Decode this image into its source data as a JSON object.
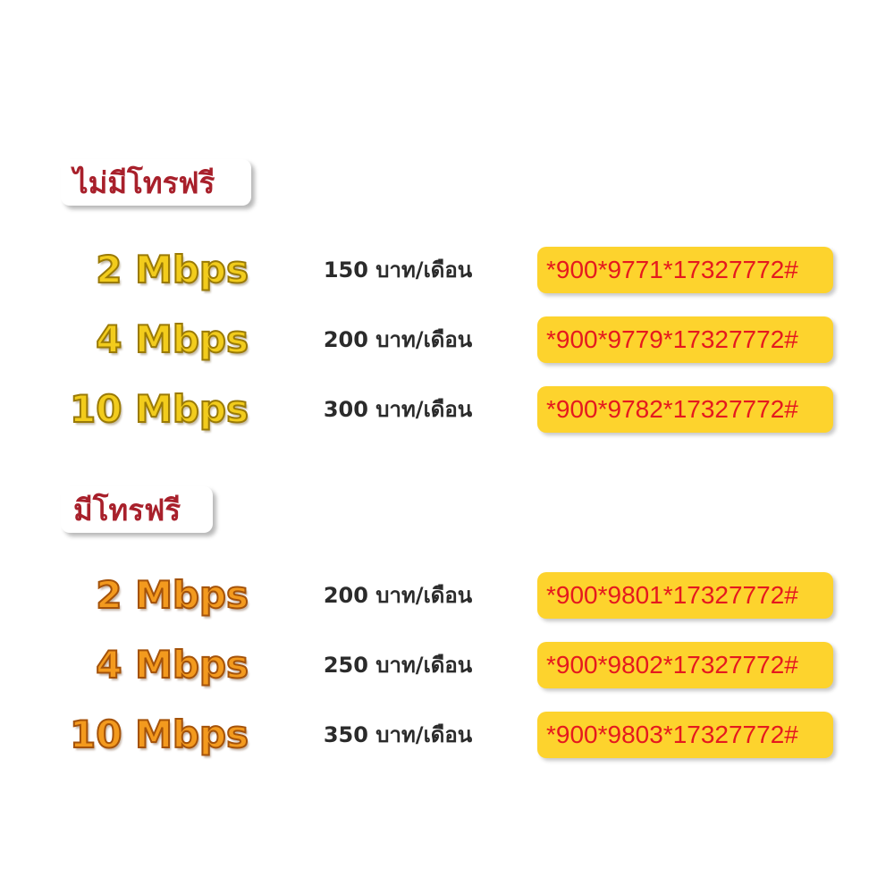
{
  "sections": [
    {
      "label": "ไม่มีโทรฟรี",
      "plans": [
        {
          "speed": "2 Mbps",
          "price": "150 บาท/เดือน",
          "code": "*900*9771*17327772#"
        },
        {
          "speed": "4 Mbps",
          "price": "200 บาท/เดือน",
          "code": "*900*9779*17327772#"
        },
        {
          "speed": "10 Mbps",
          "price": "300 บาท/เดือน",
          "code": "*900*9782*17327772#"
        }
      ]
    },
    {
      "label": "มีโทรฟรี",
      "plans": [
        {
          "speed": "2 Mbps",
          "price": "200 บาท/เดือน",
          "code": "*900*9801*17327772#"
        },
        {
          "speed": "4 Mbps",
          "price": "250 บาท/เดือน",
          "code": "*900*9802*17327772#"
        },
        {
          "speed": "10 Mbps",
          "price": "350 บาท/เดือน",
          "code": "*900*9803*17327772#"
        }
      ]
    }
  ],
  "colors": {
    "section_label": "#a8202b",
    "speed_no_call": "#f2cc1c",
    "speed_with_call": "#f39a1e",
    "code_background": "#fdd32d",
    "code_text": "#e5191e",
    "price_text": "#2b2b2b"
  }
}
